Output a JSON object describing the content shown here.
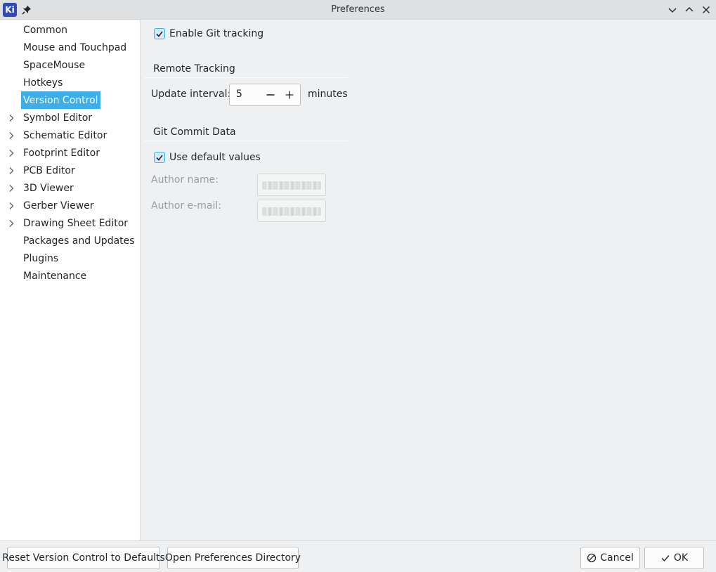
{
  "window": {
    "title": "Preferences",
    "app_icon_text": "Ki"
  },
  "sidebar": {
    "items": [
      {
        "label": "Common",
        "expandable": false,
        "selected": false
      },
      {
        "label": "Mouse and Touchpad",
        "expandable": false,
        "selected": false
      },
      {
        "label": "SpaceMouse",
        "expandable": false,
        "selected": false
      },
      {
        "label": "Hotkeys",
        "expandable": false,
        "selected": false
      },
      {
        "label": "Version Control",
        "expandable": false,
        "selected": true
      },
      {
        "label": "Symbol Editor",
        "expandable": true,
        "selected": false
      },
      {
        "label": "Schematic Editor",
        "expandable": true,
        "selected": false
      },
      {
        "label": "Footprint Editor",
        "expandable": true,
        "selected": false
      },
      {
        "label": "PCB Editor",
        "expandable": true,
        "selected": false
      },
      {
        "label": "3D Viewer",
        "expandable": true,
        "selected": false
      },
      {
        "label": "Gerber Viewer",
        "expandable": true,
        "selected": false
      },
      {
        "label": "Drawing Sheet Editor",
        "expandable": true,
        "selected": false
      },
      {
        "label": "Packages and Updates",
        "expandable": false,
        "selected": false
      },
      {
        "label": "Plugins",
        "expandable": false,
        "selected": false
      },
      {
        "label": "Maintenance",
        "expandable": false,
        "selected": false
      }
    ]
  },
  "main": {
    "enable_git": {
      "label": "Enable Git tracking",
      "checked": true
    },
    "remote_tracking": {
      "title": "Remote Tracking",
      "update_interval_label": "Update interval:",
      "update_interval_value": "5",
      "units": "minutes"
    },
    "git_commit": {
      "title": "Git Commit Data",
      "use_defaults": {
        "label": "Use default values",
        "checked": true
      },
      "author_name_label": "Author name:",
      "author_email_label": "Author e-mail:"
    }
  },
  "buttons": {
    "reset": "Reset Version Control to Defaults",
    "open_dir": "Open Preferences Directory",
    "cancel": "Cancel",
    "ok": "OK"
  },
  "colors": {
    "selection": "#3daee9",
    "titlebar": "#dee0e2",
    "panel": "#eff0f1"
  }
}
